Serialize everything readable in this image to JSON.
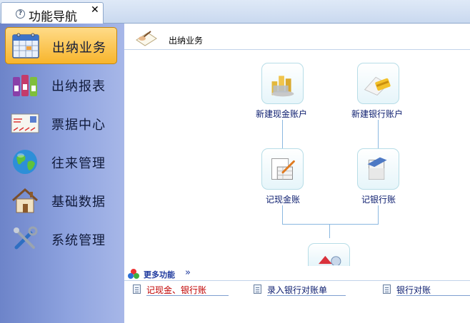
{
  "tab": {
    "title": "功能导航",
    "icon": "help-circle-icon",
    "close_glyph": "✕"
  },
  "sidebar": {
    "items": [
      {
        "label": "出纳业务",
        "icon": "calendar-grid-icon",
        "active": true
      },
      {
        "label": "出纳报表",
        "icon": "binders-icon",
        "active": false
      },
      {
        "label": "票据中心",
        "icon": "envelope-icon",
        "active": false
      },
      {
        "label": "往来管理",
        "icon": "globe-icon",
        "active": false
      },
      {
        "label": "基础数据",
        "icon": "house-icon",
        "active": false
      },
      {
        "label": "系统管理",
        "icon": "tools-icon",
        "active": false
      }
    ]
  },
  "main": {
    "title": "出纳业务",
    "flow": {
      "new_cash_account": "新建现金账户",
      "new_bank_account": "新建银行账户",
      "cash_journal": "记现金账",
      "bank_journal": "记银行账"
    },
    "more": {
      "label": "更多功能",
      "arrow": "»"
    },
    "quick_links": [
      {
        "label": "记现金、银行账",
        "color": "#c00000"
      },
      {
        "label": "录入银行对账单",
        "color": "#0b1c6e"
      },
      {
        "label": "银行对账",
        "color": "#0b1c6e"
      }
    ]
  },
  "colors": {
    "sidebar_bg": "#8ea3df",
    "active_item": "#f7b52c",
    "link_blue": "#0b1c6e",
    "connector": "#8bb8e0"
  }
}
